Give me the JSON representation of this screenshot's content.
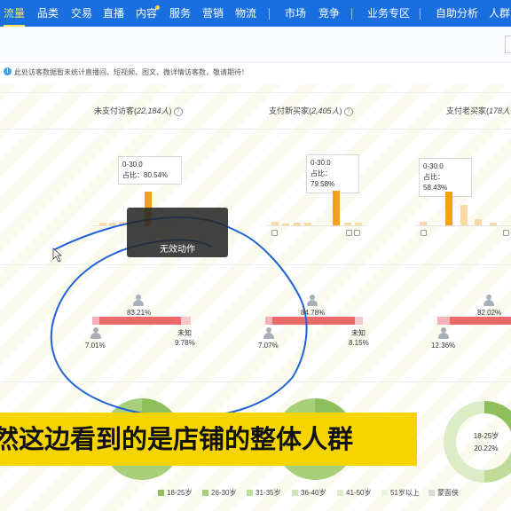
{
  "nav": {
    "items": [
      {
        "label": "流量",
        "active": true
      },
      {
        "label": "品类"
      },
      {
        "label": "交易"
      },
      {
        "label": "直播"
      },
      {
        "label": "内容",
        "dot": true
      },
      {
        "label": "服务"
      },
      {
        "label": "营销"
      },
      {
        "label": "物流"
      },
      {
        "label": "市场"
      },
      {
        "label": "竞争"
      },
      {
        "label": "业务专区"
      },
      {
        "label": "自助分析"
      },
      {
        "label": "人群"
      }
    ]
  },
  "notice": {
    "icon": "info-icon",
    "text": "此处访客数据暂未统计直播间、短视频、图文、微详情访客数，敬请期待！"
  },
  "columns": [
    {
      "title": "未支付访客",
      "count": "22,184人",
      "tooltip_range": "0-30.0",
      "tooltip_ratio": "占比：80.54%",
      "gender_main": "83.21%",
      "gender_left": "7.01%",
      "gender_unknown_label": "未知",
      "gender_unknown": "9.78%"
    },
    {
      "title": "支付新买家",
      "count": "2,405人",
      "tooltip_range": "0-30.0",
      "tooltip_ratio": "占比：79.58%",
      "gender_main": "84.78%",
      "gender_left": "7.07%",
      "gender_unknown_label": "未知",
      "gender_unknown": "8.15%"
    },
    {
      "title": "支付老买家",
      "count": "178人",
      "tooltip_range": "0-30.0",
      "tooltip_ratio": "占比：58.43%",
      "gender_main": "82.02%",
      "gender_left": "12.36%"
    }
  ],
  "toast": {
    "text": "无效动作"
  },
  "subtitle": {
    "text": "然这边看到的是店铺的整体人群"
  },
  "donut_center": {
    "label": "18-25岁",
    "value": "20.22%"
  },
  "chart_data": {
    "type": "donut",
    "legend": [
      "18-25岁",
      "26-30岁",
      "31-35岁",
      "36-40岁",
      "41-50岁",
      "51岁以上",
      "蒙面侠"
    ],
    "colors": [
      "#8fbf5a",
      "#a8d07a",
      "#bfdc98",
      "#cfe5b0",
      "#dcecc7",
      "#e9f3dd",
      "#d9d9d9"
    ]
  }
}
